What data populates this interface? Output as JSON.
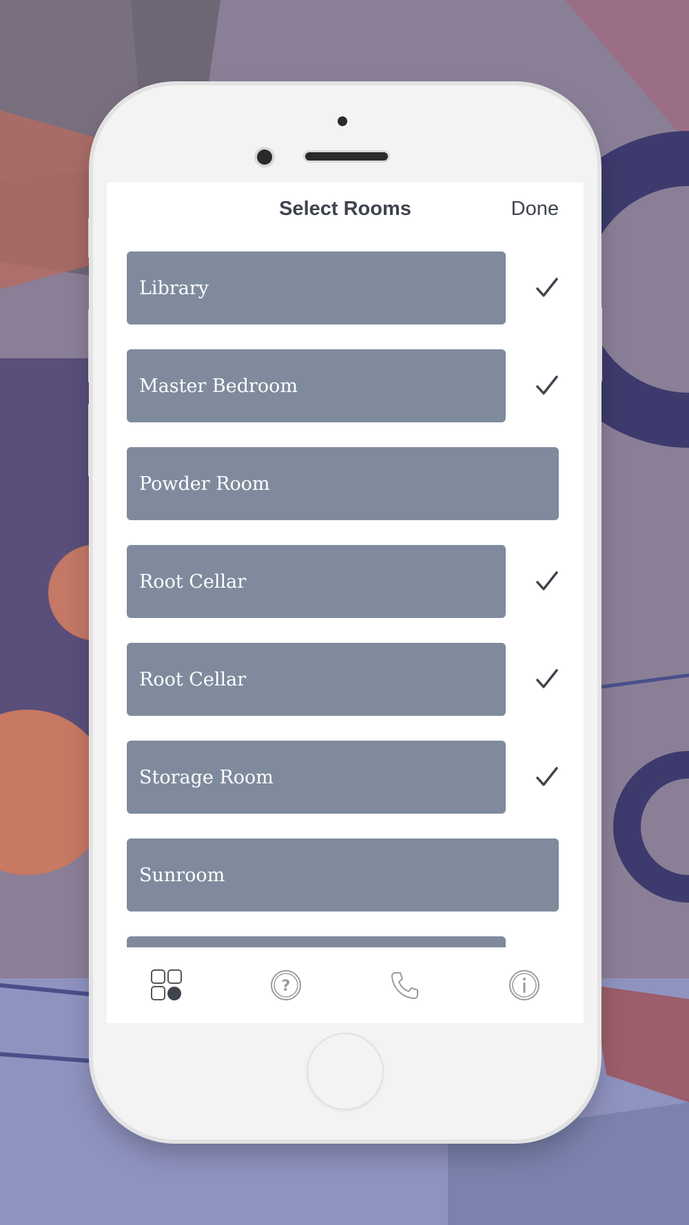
{
  "nav": {
    "title": "Select Rooms",
    "done_label": "Done"
  },
  "rooms": [
    {
      "label": "Library",
      "checked": true
    },
    {
      "label": "Master Bedroom",
      "checked": true
    },
    {
      "label": "Powder Room",
      "checked": false
    },
    {
      "label": "Root Cellar",
      "checked": true
    },
    {
      "label": "Root Cellar",
      "checked": true
    },
    {
      "label": "Storage Room",
      "checked": true
    },
    {
      "label": "Sunroom",
      "checked": false
    }
  ],
  "tabbar": {
    "tabs": [
      {
        "icon": "rooms-grid-icon",
        "active": true
      },
      {
        "icon": "help-icon",
        "active": false
      },
      {
        "icon": "phone-icon",
        "active": false
      },
      {
        "icon": "info-icon",
        "active": false
      }
    ]
  },
  "colors": {
    "row_fill": "#7f8b9d",
    "text_dark": "#3f444d",
    "icon_gray": "#9a9a9a"
  }
}
